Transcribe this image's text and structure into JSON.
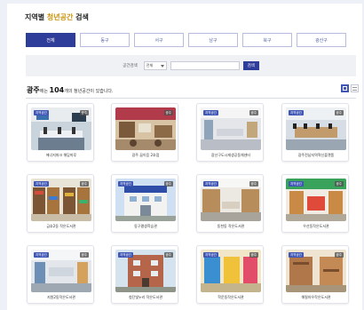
{
  "title": {
    "prefix": "지역별",
    "accent": "청년공간",
    "suffix": "검색"
  },
  "tabs": [
    "전체",
    "동구",
    "서구",
    "남구",
    "북구",
    "광산구"
  ],
  "search": {
    "label": "공간검색",
    "select_value": "전체",
    "placeholder": "",
    "button": "검색"
  },
  "results": {
    "region": "광주",
    "prefix": "에는",
    "count": "104",
    "suffix": "개의 청년공간이 있습니다."
  },
  "cards": [
    {
      "name": "에너지파크 해담마루",
      "badge_left": "지역공간",
      "badge_right": "광주"
    },
    {
      "name": "광주 꿈이음 2호점",
      "badge_left": "",
      "badge_right": "광주"
    },
    {
      "name": "광산구도시재생공동체센터",
      "badge_left": "지역공간",
      "badge_right": "광주"
    },
    {
      "name": "광주전남지역혁신플랫폼",
      "badge_left": "지역공간",
      "badge_right": "광주"
    },
    {
      "name": "금호2동 작은도서관",
      "badge_left": "지역공간",
      "badge_right": "광주"
    },
    {
      "name": "동구평생학습관",
      "badge_left": "지역공간",
      "badge_right": "광주"
    },
    {
      "name": "동천동 작은도서관",
      "badge_left": "지역공간",
      "badge_right": "광주"
    },
    {
      "name": "우산동작은도서관",
      "badge_left": "지역공간",
      "badge_right": "광주"
    },
    {
      "name": "지원2동작은도서관",
      "badge_left": "지역공간",
      "badge_right": "광주"
    },
    {
      "name": "첨단빛누리 작은도서관",
      "badge_left": "지역공간",
      "badge_right": "광주"
    },
    {
      "name": "학운동작은도서관",
      "badge_left": "지역공간",
      "badge_right": "광주"
    },
    {
      "name": "해필하우작은도서관",
      "badge_left": "지역공간",
      "badge_right": "광주"
    }
  ],
  "icons": {
    "grid_view": "grid-view-icon",
    "list_view": "list-view-icon",
    "select_caret": "chevron-down-icon"
  },
  "colors": {
    "primary": "#2f3d9a",
    "accent": "#c9930e",
    "badge": "#3f56b5"
  }
}
